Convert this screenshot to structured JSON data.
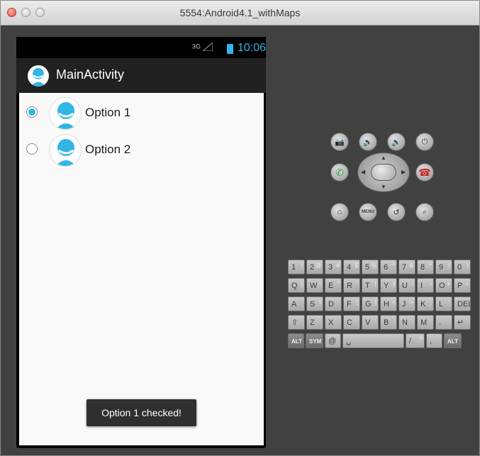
{
  "window": {
    "title": "5554:Android4.1_withMaps"
  },
  "statusbar": {
    "network": "3G",
    "time": "10:06"
  },
  "actionbar": {
    "title": "MainActivity"
  },
  "options": [
    {
      "label": "Option 1",
      "checked": true
    },
    {
      "label": "Option 2",
      "checked": false
    }
  ],
  "toast": {
    "text": "Option 1 checked!"
  },
  "controls": {
    "menu_label": "MENU"
  },
  "keyboard": {
    "row1": [
      {
        "main": "1",
        "alt": "!"
      },
      {
        "main": "2",
        "alt": "@"
      },
      {
        "main": "3",
        "alt": "#"
      },
      {
        "main": "4",
        "alt": "$"
      },
      {
        "main": "5",
        "alt": "%"
      },
      {
        "main": "6",
        "alt": "^"
      },
      {
        "main": "7",
        "alt": "&"
      },
      {
        "main": "8",
        "alt": "*"
      },
      {
        "main": "9",
        "alt": "("
      },
      {
        "main": "0",
        "alt": ")"
      }
    ],
    "row2": [
      {
        "main": "Q",
        "alt": "|"
      },
      {
        "main": "W",
        "alt": "~"
      },
      {
        "main": "E",
        "alt": "\""
      },
      {
        "main": "R",
        "alt": "`"
      },
      {
        "main": "T",
        "alt": "{"
      },
      {
        "main": "Y",
        "alt": "}"
      },
      {
        "main": "U",
        "alt": "-"
      },
      {
        "main": "I",
        "alt": "-"
      },
      {
        "main": "O",
        "alt": "+"
      },
      {
        "main": "P",
        "alt": "="
      }
    ],
    "row3": [
      {
        "main": "A",
        "alt": ""
      },
      {
        "main": "S",
        "alt": "\\"
      },
      {
        "main": "D",
        "alt": ""
      },
      {
        "main": "F",
        "alt": "["
      },
      {
        "main": "G",
        "alt": "]"
      },
      {
        "main": "H",
        "alt": "<"
      },
      {
        "main": "J",
        "alt": ">"
      },
      {
        "main": "K",
        "alt": ";"
      },
      {
        "main": "L",
        "alt": ":"
      },
      {
        "main": "DEL",
        "alt": ""
      }
    ],
    "row4": [
      {
        "main": "⇧",
        "alt": ""
      },
      {
        "main": "Z",
        "alt": ""
      },
      {
        "main": "X",
        "alt": ""
      },
      {
        "main": "C",
        "alt": ""
      },
      {
        "main": "V",
        "alt": ""
      },
      {
        "main": "B",
        "alt": ""
      },
      {
        "main": "N",
        "alt": ""
      },
      {
        "main": "M",
        "alt": ""
      },
      {
        "main": ".",
        "alt": ""
      },
      {
        "main": "↵",
        "alt": ""
      }
    ],
    "row5": [
      {
        "main": "ALT",
        "alt": ""
      },
      {
        "main": "SYM",
        "alt": ""
      },
      {
        "main": "@",
        "alt": ""
      },
      {
        "main": "␣",
        "alt": ""
      },
      {
        "main": "/",
        "alt": "?"
      },
      {
        "main": ",",
        "alt": ""
      },
      {
        "main": "ALT",
        "alt": ""
      }
    ]
  },
  "colors": {
    "accent": "#33b5e5",
    "actionbar": "#212121",
    "screen_bg": "#f9f9f9"
  },
  "icons": {
    "camera": "camera-icon",
    "vol_down": "volume-down-icon",
    "vol_up": "volume-up-icon",
    "power": "power-icon",
    "call": "call-icon",
    "end_call": "end-call-icon",
    "home": "home-icon",
    "back": "back-icon",
    "search": "search-icon"
  }
}
